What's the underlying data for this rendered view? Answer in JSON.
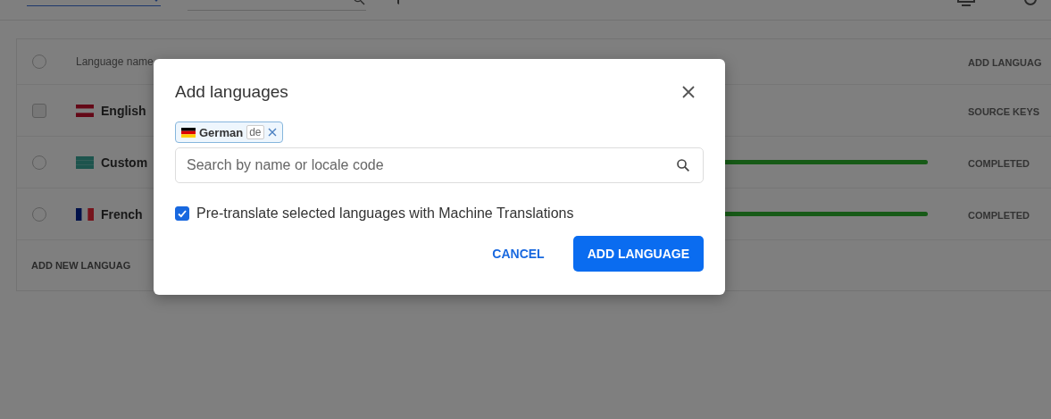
{
  "table": {
    "header": {
      "selected": false,
      "columns": [
        "Language name",
        "ADD LANGUAG"
      ]
    },
    "rows": [
      {
        "name": "English",
        "flag": {
          "kind": "gb"
        },
        "status": "SOURCE KEYS",
        "kind": "source",
        "selected": false,
        "disabled": true
      },
      {
        "name": "Custom",
        "flag": {
          "kind": "custom"
        },
        "status": "COMPLETED",
        "kind": "target",
        "level": 1,
        "selected": false,
        "disabled": false
      },
      {
        "name": "French",
        "flag": {
          "kind": "fr"
        },
        "status": "COMPLETED",
        "kind": "target",
        "level": 1,
        "selected": false,
        "disabled": false
      }
    ],
    "footer": "ADD NEW LANGUAG"
  },
  "dialog": {
    "title": "Add languages",
    "chips": [
      {
        "label": "German",
        "code": "de",
        "flag": {
          "kind": "de"
        }
      }
    ],
    "search": {
      "placeholder": "Search by name or locale code"
    },
    "pretranslate": {
      "label": "Pre-translate selected languages with Machine Translations",
      "checked": true
    },
    "buttons": [
      {
        "label": "CANCEL",
        "kind": "text"
      },
      {
        "label": "ADD LANGUAGE",
        "kind": "primary"
      }
    ]
  }
}
